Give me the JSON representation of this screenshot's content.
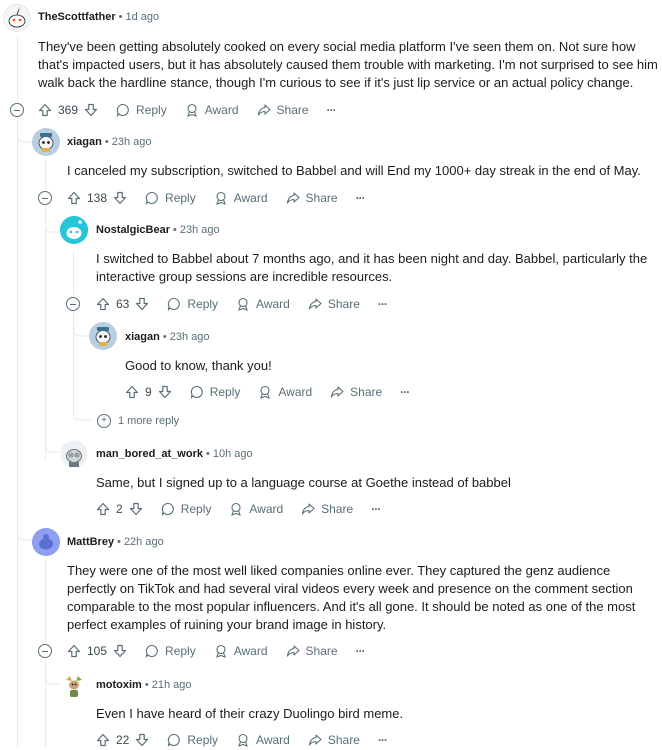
{
  "comments": [
    {
      "user": "TheScottfather",
      "time": "1d ago",
      "text": "They've been getting absolutely cooked on every social media platform I've seen them on. Not sure how that's impacted users, but it has absolutely caused them trouble with marketing. I'm not surprised to see him walk back the hardline stance, though I'm curious to see if it's just lip service or an actual policy change.",
      "votes": "369",
      "avatar_color": "#ffffff"
    },
    {
      "user": "xiagan",
      "time": "23h ago",
      "text": "I canceled my subscription, switched to Babbel and will End my 1000+ day streak in the end of May.",
      "votes": "138",
      "avatar_color": "#b9cfe0"
    },
    {
      "user": "NostalgicBear",
      "time": "23h ago",
      "text": "I switched to Babbel about 7 months ago, and it has been night and day. Babbel, particularly the interactive group sessions are incredible resources.",
      "votes": "63",
      "avatar_color": "#24c6d8"
    },
    {
      "user": "xiagan",
      "time": "23h ago",
      "text": "Good to know, thank you!",
      "votes": "9",
      "avatar_color": "#b9cfe0"
    },
    {
      "user": "man_bored_at_work",
      "time": "10h ago",
      "text": "Same, but I signed up to a language course at Goethe instead of babbel",
      "votes": "2",
      "avatar_color": "#d0d6da"
    },
    {
      "user": "MattBrey",
      "time": "22h ago",
      "text": "They were one of the most well liked companies online ever. They captured the genz audience perfectly on TikTok and had several viral videos every week and presence on the comment section comparable to the most popular influencers. And it's all gone. It should be noted as one of the most perfect examples of ruining your brand image in history.",
      "votes": "105",
      "avatar_color": "#8c9ff0"
    },
    {
      "user": "motoxim",
      "time": "21h ago",
      "text": "Even I have heard of their crazy Duolingo bird meme.",
      "votes": "22",
      "avatar_color": "#ffffff"
    }
  ],
  "labels": {
    "reply": "Reply",
    "award": "Award",
    "share": "Share",
    "more": "···",
    "dot": "•"
  },
  "more_replies": "1 more reply"
}
